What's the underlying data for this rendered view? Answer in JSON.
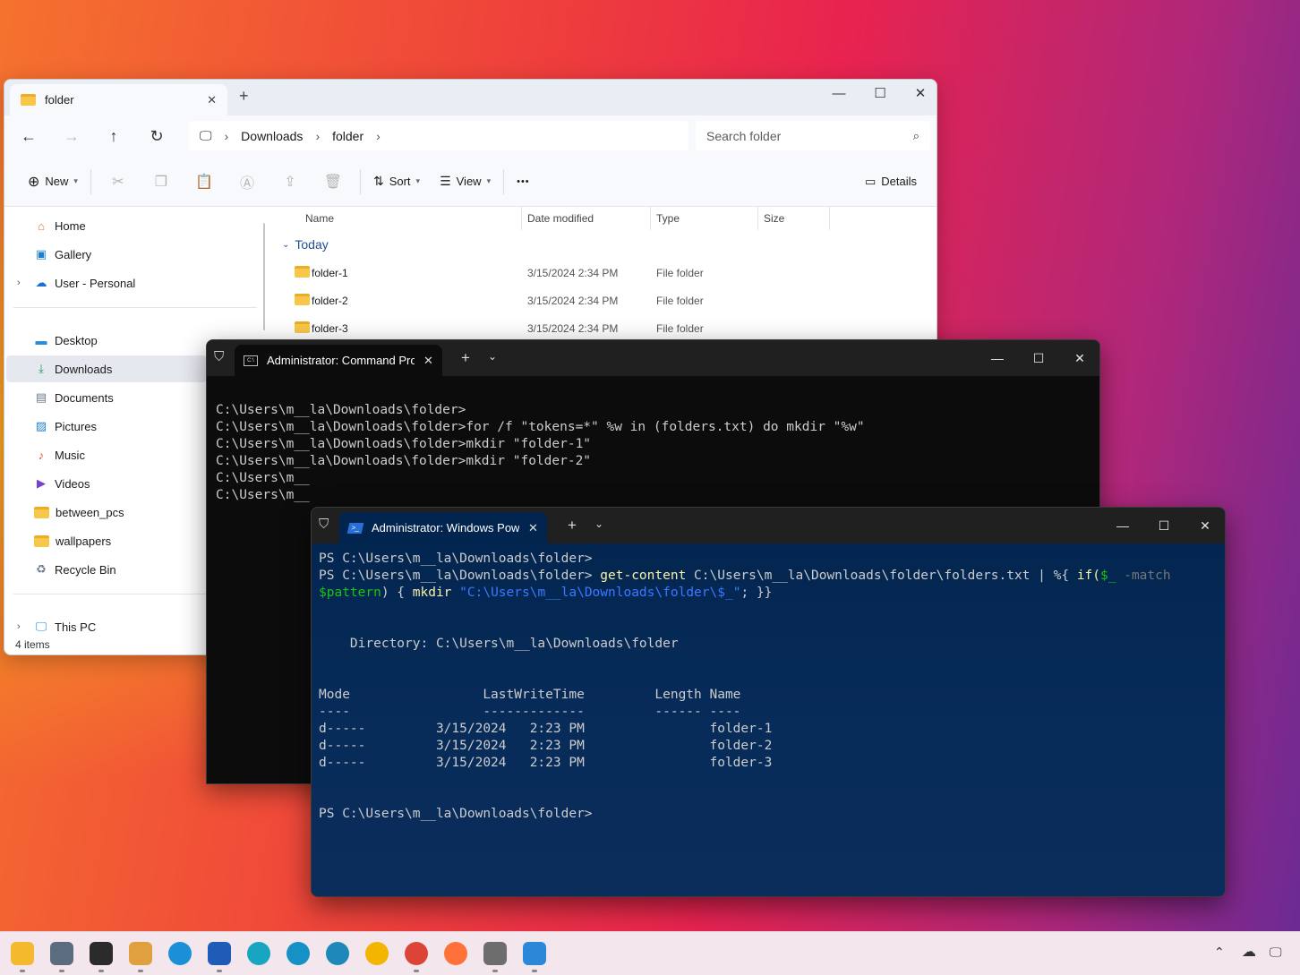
{
  "explorer": {
    "tab_title": "folder",
    "new_tab": "+",
    "window_controls": {
      "minimize": "—",
      "maximize": "☐",
      "close": "✕"
    },
    "breadcrumb": [
      "Downloads",
      "folder"
    ],
    "search_placeholder": "Search folder",
    "toolbar": {
      "new_label": "New",
      "sort_label": "Sort",
      "view_label": "View",
      "more_label": "•••",
      "details_label": "Details"
    },
    "sidebar": {
      "quick": [
        {
          "label": "Home",
          "icon": "home-icon"
        },
        {
          "label": "Gallery",
          "icon": "gallery-icon"
        },
        {
          "label": "User - Personal",
          "icon": "onedrive-icon"
        }
      ],
      "pinned": [
        {
          "label": "Desktop",
          "icon": "desktop-icon"
        },
        {
          "label": "Downloads",
          "icon": "download-icon"
        },
        {
          "label": "Documents",
          "icon": "documents-icon"
        },
        {
          "label": "Pictures",
          "icon": "pictures-icon"
        },
        {
          "label": "Music",
          "icon": "music-icon"
        },
        {
          "label": "Videos",
          "icon": "videos-icon"
        },
        {
          "label": "between_pcs",
          "icon": "folder-icon"
        },
        {
          "label": "wallpapers",
          "icon": "folder-icon"
        },
        {
          "label": "Recycle Bin",
          "icon": "recycle-bin-icon"
        }
      ],
      "this_pc": "This PC"
    },
    "columns": {
      "name": "Name",
      "date": "Date modified",
      "type": "Type",
      "size": "Size"
    },
    "group_label": "Today",
    "files": [
      {
        "name": "folder-1",
        "date": "3/15/2024 2:34 PM",
        "type": "File folder"
      },
      {
        "name": "folder-2",
        "date": "3/15/2024 2:34 PM",
        "type": "File folder"
      },
      {
        "name": "folder-3",
        "date": "3/15/2024 2:34 PM",
        "type": "File folder"
      }
    ],
    "status": "4 items"
  },
  "cmd": {
    "tab_title": "Administrator: Command Pro",
    "lines": [
      "C:\\Users\\m__la\\Downloads\\folder>",
      "C:\\Users\\m__la\\Downloads\\folder>for /f \"tokens=*\" %w in (folders.txt) do mkdir \"%w\"",
      "",
      "C:\\Users\\m__la\\Downloads\\folder>mkdir \"folder-1\"",
      "",
      "C:\\Users\\m__la\\Downloads\\folder>mkdir \"folder-2\"",
      "",
      "C:\\Users\\m__",
      "",
      "C:\\Users\\m__"
    ]
  },
  "powershell": {
    "tab_title": "Administrator: Windows Powe",
    "prompt1": "PS C:\\Users\\m__la\\Downloads\\folder>",
    "prompt2": "PS C:\\Users\\m__la\\Downloads\\folder> ",
    "cmd_get_content": "get-content",
    "cmd_path": " C:\\Users\\m__la\\Downloads\\folder\\folders.txt | %{ ",
    "cmd_if": "if(",
    "cmd_var": "$_",
    "cmd_match": " -match",
    "cmd_pattern": "$pattern",
    "cmd_brace": ") { ",
    "cmd_mkdir": "mkdir",
    "cmd_string": " \"C:\\Users\\m__la\\Downloads\\folder\\$_\"",
    "cmd_end": "; }}",
    "directory_line": "    Directory: C:\\Users\\m__la\\Downloads\\folder",
    "table_header": "Mode                 LastWriteTime         Length Name",
    "table_rule": "----                 -------------         ------ ----",
    "rows": [
      "d-----         3/15/2024   2:23 PM                folder-1",
      "d-----         3/15/2024   2:23 PM                folder-2",
      "d-----         3/15/2024   2:23 PM                folder-3"
    ],
    "prompt_final": "PS C:\\Users\\m__la\\Downloads\\folder>"
  },
  "taskbar": {
    "apps": [
      {
        "name": "file-explorer-icon",
        "color": "#f5b92d"
      },
      {
        "name": "settings-icon",
        "color": "#5a6c7d"
      },
      {
        "name": "terminal-icon",
        "color": "#2b2b2b"
      },
      {
        "name": "notepad-plus-icon",
        "color": "#e0a040"
      },
      {
        "name": "edge-icon",
        "color": "#1b8fd8"
      },
      {
        "name": "store-icon",
        "color": "#1f5cb8"
      },
      {
        "name": "edge-canary-icon",
        "color": "#17a6c2"
      },
      {
        "name": "edge-beta-icon",
        "color": "#1591c5"
      },
      {
        "name": "edge-dev-icon",
        "color": "#1e88b8"
      },
      {
        "name": "chrome-canary-icon",
        "color": "#f4b400"
      },
      {
        "name": "chrome-icon",
        "color": "#db4437"
      },
      {
        "name": "firefox-icon",
        "color": "#ff7139"
      },
      {
        "name": "installer-icon",
        "color": "#6d6d6d"
      },
      {
        "name": "notepad-icon",
        "color": "#2b88d8"
      }
    ],
    "tray": {
      "chevron": "⌃",
      "cloud": "☁",
      "display": "🖵"
    }
  }
}
